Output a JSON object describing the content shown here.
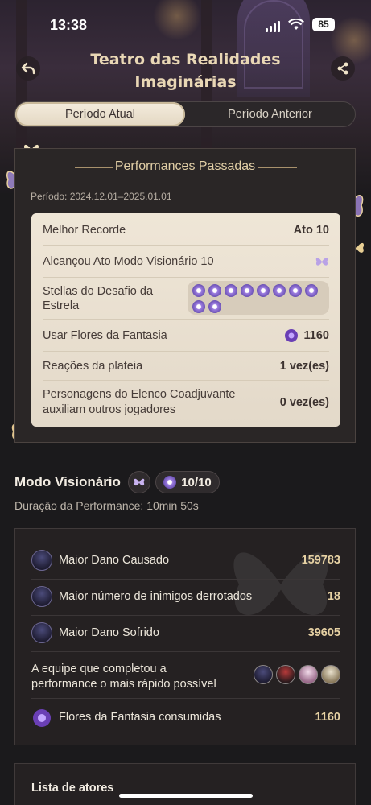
{
  "status_bar": {
    "time": "13:38",
    "battery": "85"
  },
  "header": {
    "title_line1": "Teatro das Realidades",
    "title_line2": "Imaginárias"
  },
  "tabs": [
    {
      "label": "Período Atual",
      "active": true
    },
    {
      "label": "Período Anterior",
      "active": false
    }
  ],
  "past_performances": {
    "heading": "Performances Passadas",
    "period": "Período: 2024.12.01–2025.01.01",
    "rows": [
      {
        "label": "Melhor Recorde",
        "value": "Ato 10"
      },
      {
        "label": "Alcançou Ato Modo Visionário 10",
        "value": ""
      },
      {
        "label_line1": "Stellas do Desafio da",
        "label_line2": "Estrela",
        "stars_count": 10
      },
      {
        "label": "Usar Flores da Fantasia",
        "value": "1160"
      },
      {
        "label": "Reações da plateia",
        "value": "1 vez(es)"
      },
      {
        "label_line1": "Personagens do Elenco Coadjuvante",
        "label_line2": "auxiliam outros jogadores",
        "value": "0 vez(es)"
      }
    ]
  },
  "visionary": {
    "title": "Modo Visionário",
    "score": "10/10",
    "duration": "Duração da Performance: 10min 50s"
  },
  "stats": [
    {
      "label": "Maior Dano Causado",
      "value": "159783"
    },
    {
      "label": "Maior número de inimigos derrotados",
      "value": "18"
    },
    {
      "label": "Maior Dano Sofrido",
      "value": "39605"
    },
    {
      "label_line1": "A equipe que completou a",
      "label_line2": "performance o mais rápido possível"
    },
    {
      "label": "Flores da Fantasia consumidas",
      "value": "1160"
    }
  ],
  "actors": {
    "title": "Lista de atores"
  },
  "colors": {
    "accent_gold": "#e2cfa6",
    "card_bg": "#efe6d7",
    "panel_bg": "#2a2626",
    "star_purple": "#7d60c8"
  }
}
